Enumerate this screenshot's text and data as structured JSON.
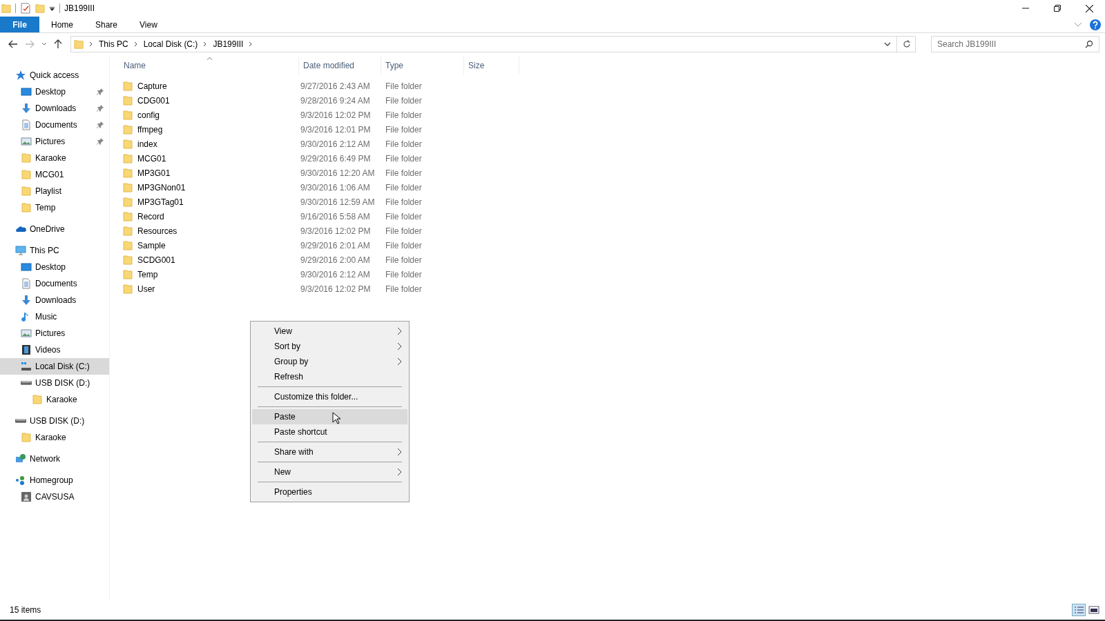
{
  "window": {
    "title": "JB199III"
  },
  "ribbon": {
    "tabs": [
      {
        "label": "File",
        "kind": "file"
      },
      {
        "label": "Home",
        "kind": "tab"
      },
      {
        "label": "Share",
        "kind": "tab"
      },
      {
        "label": "View",
        "kind": "tab"
      }
    ]
  },
  "address": {
    "crumbs": [
      "This PC",
      "Local Disk (C:)",
      "JB199III"
    ]
  },
  "search": {
    "placeholder": "Search JB199III"
  },
  "sidebar": {
    "items": [
      {
        "label": "Quick access",
        "kind": "star",
        "selected": false,
        "children": [
          {
            "label": "Desktop",
            "kind": "desktop",
            "pinned": true,
            "selected": false
          },
          {
            "label": "Downloads",
            "kind": "download",
            "pinned": true,
            "selected": false
          },
          {
            "label": "Documents",
            "kind": "document",
            "pinned": true,
            "selected": false
          },
          {
            "label": "Pictures",
            "kind": "picture",
            "pinned": true,
            "selected": false
          },
          {
            "label": "Karaoke",
            "kind": "folder",
            "pinned": false,
            "selected": false
          },
          {
            "label": "MCG01",
            "kind": "folder",
            "pinned": false,
            "selected": false
          },
          {
            "label": "Playlist",
            "kind": "folder",
            "pinned": false,
            "selected": false
          },
          {
            "label": "Temp",
            "kind": "folder",
            "pinned": false,
            "selected": false
          }
        ]
      },
      {
        "label": "OneDrive",
        "kind": "cloud",
        "selected": false
      },
      {
        "label": "This PC",
        "kind": "pc",
        "selected": false,
        "children": [
          {
            "label": "Desktop",
            "kind": "desktop",
            "selected": false
          },
          {
            "label": "Documents",
            "kind": "document",
            "selected": false
          },
          {
            "label": "Downloads",
            "kind": "download",
            "selected": false
          },
          {
            "label": "Music",
            "kind": "music",
            "selected": false
          },
          {
            "label": "Pictures",
            "kind": "picture",
            "selected": false
          },
          {
            "label": "Videos",
            "kind": "video",
            "selected": false
          },
          {
            "label": "Local Disk (C:)",
            "kind": "localdisk",
            "selected": true
          },
          {
            "label": "USB DISK (D:)",
            "kind": "usb",
            "selected": false,
            "children": [
              {
                "label": "Karaoke",
                "kind": "folder",
                "selected": false
              }
            ]
          }
        ]
      },
      {
        "label": "USB DISK (D:)",
        "kind": "usb",
        "selected": false,
        "children": [
          {
            "label": "Karaoke",
            "kind": "folder",
            "selected": false
          }
        ]
      },
      {
        "label": "Network",
        "kind": "network",
        "selected": false
      },
      {
        "label": "Homegroup",
        "kind": "homegroup",
        "selected": false,
        "children": [
          {
            "label": "CAVSUSA",
            "kind": "user",
            "selected": false
          }
        ]
      }
    ]
  },
  "table": {
    "columns": [
      {
        "label": "Name",
        "sorted": true
      },
      {
        "label": "Date modified",
        "sorted": false
      },
      {
        "label": "Type",
        "sorted": false
      },
      {
        "label": "Size",
        "sorted": false
      }
    ],
    "rows": [
      {
        "name": "Capture",
        "date": "9/27/2016 2:43 AM",
        "type": "File folder"
      },
      {
        "name": "CDG001",
        "date": "9/28/2016 9:24 AM",
        "type": "File folder"
      },
      {
        "name": "config",
        "date": "9/3/2016 12:02 PM",
        "type": "File folder"
      },
      {
        "name": "ffmpeg",
        "date": "9/3/2016 12:01 PM",
        "type": "File folder"
      },
      {
        "name": "index",
        "date": "9/30/2016 2:12 AM",
        "type": "File folder"
      },
      {
        "name": "MCG01",
        "date": "9/29/2016 6:49 PM",
        "type": "File folder"
      },
      {
        "name": "MP3G01",
        "date": "9/30/2016 12:20 AM",
        "type": "File folder"
      },
      {
        "name": "MP3GNon01",
        "date": "9/30/2016 1:06 AM",
        "type": "File folder"
      },
      {
        "name": "MP3GTag01",
        "date": "9/30/2016 12:59 AM",
        "type": "File folder"
      },
      {
        "name": "Record",
        "date": "9/16/2016 5:58 AM",
        "type": "File folder"
      },
      {
        "name": "Resources",
        "date": "9/3/2016 12:02 PM",
        "type": "File folder"
      },
      {
        "name": "Sample",
        "date": "9/29/2016 2:01 AM",
        "type": "File folder"
      },
      {
        "name": "SCDG001",
        "date": "9/29/2016 2:00 AM",
        "type": "File folder"
      },
      {
        "name": "Temp",
        "date": "9/30/2016 2:12 AM",
        "type": "File folder"
      },
      {
        "name": "User",
        "date": "9/3/2016 12:02 PM",
        "type": "File folder"
      }
    ]
  },
  "context_menu": {
    "groups": [
      [
        {
          "label": "View",
          "submenu": true,
          "selected": false
        },
        {
          "label": "Sort by",
          "submenu": true,
          "selected": false
        },
        {
          "label": "Group by",
          "submenu": true,
          "selected": false
        },
        {
          "label": "Refresh",
          "submenu": false,
          "selected": false
        }
      ],
      [
        {
          "label": "Customize this folder...",
          "submenu": false,
          "selected": false
        }
      ],
      [
        {
          "label": "Paste",
          "submenu": false,
          "selected": true
        },
        {
          "label": "Paste shortcut",
          "submenu": false,
          "selected": false
        }
      ],
      [
        {
          "label": "Share with",
          "submenu": true,
          "selected": false
        }
      ],
      [
        {
          "label": "New",
          "submenu": true,
          "selected": false
        }
      ],
      [
        {
          "label": "Properties",
          "submenu": false,
          "selected": false
        }
      ]
    ]
  },
  "status_bar": {
    "text": "15 items"
  }
}
